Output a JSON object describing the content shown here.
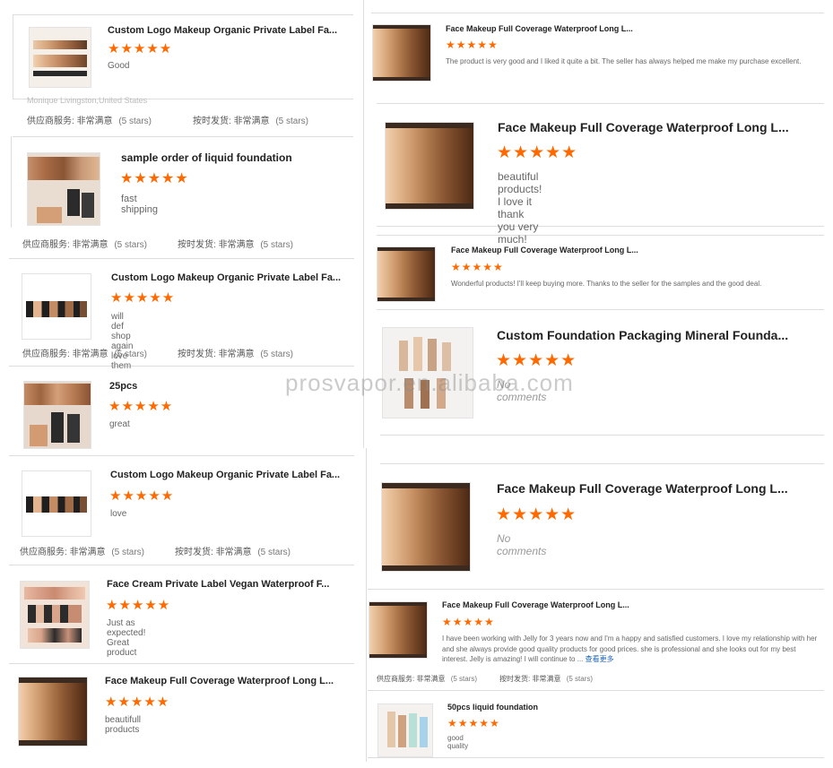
{
  "watermark": "prosvapor.en.alibaba.com",
  "stars": "★★★★★",
  "meta_labels": {
    "service_label": "供应商服务:",
    "service_value": "非常满意",
    "delivery_label": "按时发货:",
    "delivery_value": "非常满意",
    "rating": "(5 stars)"
  },
  "faded_name": "Monique Livingston,United States",
  "see_more": "查看更多",
  "left_reviews": [
    {
      "title": "Custom Logo Makeup Organic Private Label Fa...",
      "comment": "Good"
    },
    {
      "title": "sample order of liquid foundation",
      "comment": "fast shipping"
    },
    {
      "title": "Custom Logo Makeup Organic Private Label Fa...",
      "comment": "will def shop again love them"
    },
    {
      "title": "25pcs",
      "comment": "great"
    },
    {
      "title": "Custom Logo Makeup Organic Private Label Fa...",
      "comment": "love"
    },
    {
      "title": "Face Cream Private Label Vegan Waterproof F...",
      "comment": "Just as expected! Great product"
    },
    {
      "title": "Face Makeup Full Coverage Waterproof Long L...",
      "comment": "beautifull products"
    }
  ],
  "right_reviews": [
    {
      "title": "Face Makeup Full Coverage Waterproof Long L...",
      "comment": "The product is very good and I liked it quite a bit. The seller has always helped me make my purchase excellent."
    },
    {
      "title": "Face Makeup Full Coverage Waterproof Long L...",
      "comment": "beautiful products! I love it thank you very much!"
    },
    {
      "title": "Face Makeup Full Coverage Waterproof Long L...",
      "comment": "Wonderful products! I'll keep buying more. Thanks to the seller for the samples and the good deal."
    },
    {
      "title": "Custom Foundation Packaging Mineral Founda...",
      "comment": "No comments"
    },
    {
      "title": "Face Makeup Full Coverage Waterproof Long L...",
      "comment": "No comments"
    },
    {
      "title": "Face Makeup Full Coverage Waterproof Long L...",
      "comment": "I have been working with Jelly for 3 years now and I'm a happy and satisfied customers. I love my relationship with her and she always provide good quality products for good prices. she is professional and she looks out for my best interest. Jelly is amazing! I will continue to ..."
    },
    {
      "title": "50pcs liquid foundation",
      "comment": "good quality"
    }
  ],
  "colors": {
    "star": "#ff6a00",
    "link": "#1a64b8",
    "divider": "#dddddd"
  }
}
